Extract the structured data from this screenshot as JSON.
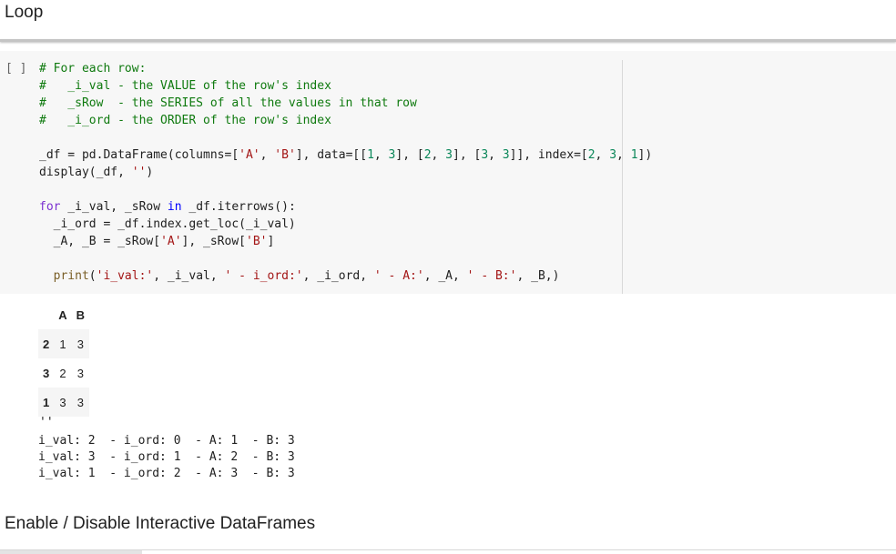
{
  "heading_loop": "Loop",
  "heading_next": "Enable / Disable Interactive DataFrames",
  "cell": {
    "run_indicator": "[ ]",
    "lines": [
      [
        {
          "c": "c",
          "t": "# For each row:"
        }
      ],
      [
        {
          "c": "c",
          "t": "#   _i_val - the VALUE of the row's index"
        }
      ],
      [
        {
          "c": "c",
          "t": "#   _sRow  - the SERIES of all the values in that row"
        }
      ],
      [
        {
          "c": "c",
          "t": "#   _i_ord - the ORDER of the row's index"
        }
      ],
      [],
      [
        {
          "c": "",
          "t": "_df = pd.DataFrame(columns=["
        },
        {
          "c": "s",
          "t": "'A'"
        },
        {
          "c": "",
          "t": ", "
        },
        {
          "c": "s",
          "t": "'B'"
        },
        {
          "c": "",
          "t": "], data=[["
        },
        {
          "c": "n",
          "t": "1"
        },
        {
          "c": "",
          "t": ", "
        },
        {
          "c": "n",
          "t": "3"
        },
        {
          "c": "",
          "t": "], ["
        },
        {
          "c": "n",
          "t": "2"
        },
        {
          "c": "",
          "t": ", "
        },
        {
          "c": "n",
          "t": "3"
        },
        {
          "c": "",
          "t": "], ["
        },
        {
          "c": "n",
          "t": "3"
        },
        {
          "c": "",
          "t": ", "
        },
        {
          "c": "n",
          "t": "3"
        },
        {
          "c": "",
          "t": "]], index=["
        },
        {
          "c": "n",
          "t": "2"
        },
        {
          "c": "",
          "t": ", "
        },
        {
          "c": "n",
          "t": "3"
        },
        {
          "c": "",
          "t": ", "
        },
        {
          "c": "n",
          "t": "1"
        },
        {
          "c": "",
          "t": "])"
        }
      ],
      [
        {
          "c": "",
          "t": "display(_df, "
        },
        {
          "c": "s",
          "t": "''"
        },
        {
          "c": "",
          "t": ")"
        }
      ],
      [],
      [
        {
          "c": "k",
          "t": "for"
        },
        {
          "c": "",
          "t": " _i_val, _sRow "
        },
        {
          "c": "kb",
          "t": "in"
        },
        {
          "c": "",
          "t": " _df.iterrows():"
        }
      ],
      [
        {
          "c": "",
          "t": "  _i_ord = _df.index.get_loc(_i_val)"
        }
      ],
      [
        {
          "c": "",
          "t": "  _A, _B = _sRow["
        },
        {
          "c": "s",
          "t": "'A'"
        },
        {
          "c": "",
          "t": "], _sRow["
        },
        {
          "c": "s",
          "t": "'B'"
        },
        {
          "c": "",
          "t": "]"
        }
      ],
      [],
      [
        {
          "c": "",
          "t": "  "
        },
        {
          "c": "f",
          "t": "print"
        },
        {
          "c": "",
          "t": "("
        },
        {
          "c": "s",
          "t": "'i_val:'"
        },
        {
          "c": "",
          "t": ", _i_val, "
        },
        {
          "c": "s",
          "t": "' - i_ord:'"
        },
        {
          "c": "",
          "t": ", _i_ord, "
        },
        {
          "c": "s",
          "t": "' - A:'"
        },
        {
          "c": "",
          "t": ", _A, "
        },
        {
          "c": "s",
          "t": "' - B:'"
        },
        {
          "c": "",
          "t": ", _B,)"
        }
      ]
    ]
  },
  "output": {
    "table": {
      "columns": [
        "A",
        "B"
      ],
      "rows": [
        {
          "index": "2",
          "A": "1",
          "B": "3"
        },
        {
          "index": "3",
          "A": "2",
          "B": "3"
        },
        {
          "index": "1",
          "A": "3",
          "B": "3"
        }
      ]
    },
    "repr_line": "''",
    "print_lines": [
      "i_val: 2  - i_ord: 0  - A: 1  - B: 3",
      "i_val: 3  - i_ord: 1  - A: 2  - B: 3",
      "i_val: 1  - i_ord: 2  - A: 3  - B: 3"
    ]
  }
}
